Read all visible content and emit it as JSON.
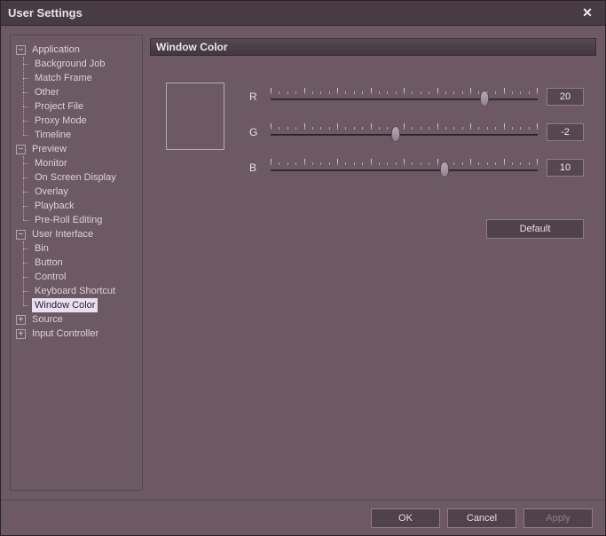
{
  "window": {
    "title": "User Settings",
    "close_glyph": "✕"
  },
  "tree": {
    "application": {
      "label": "Application",
      "expanded": true,
      "items": [
        "Background Job",
        "Match Frame",
        "Other",
        "Project File",
        "Proxy Mode",
        "Timeline"
      ]
    },
    "preview": {
      "label": "Preview",
      "expanded": true,
      "items": [
        "Monitor",
        "On Screen Display",
        "Overlay",
        "Playback",
        "Pre-Roll Editing"
      ]
    },
    "user_interface": {
      "label": "User Interface",
      "expanded": true,
      "items": [
        "Bin",
        "Button",
        "Control",
        "Keyboard Shortcut",
        "Window Color"
      ],
      "selected": "Window Color"
    },
    "source": {
      "label": "Source",
      "expanded": false
    },
    "input_controller": {
      "label": "Input Controller",
      "expanded": false
    }
  },
  "panel": {
    "title": "Window Color",
    "channels": {
      "r": {
        "label": "R",
        "value": "20",
        "thumb_pct": 80
      },
      "g": {
        "label": "G",
        "value": "-2",
        "thumb_pct": 47
      },
      "b": {
        "label": "B",
        "value": "10",
        "thumb_pct": 65
      }
    },
    "default_label": "Default"
  },
  "footer": {
    "ok": "OK",
    "cancel": "Cancel",
    "apply": "Apply"
  }
}
